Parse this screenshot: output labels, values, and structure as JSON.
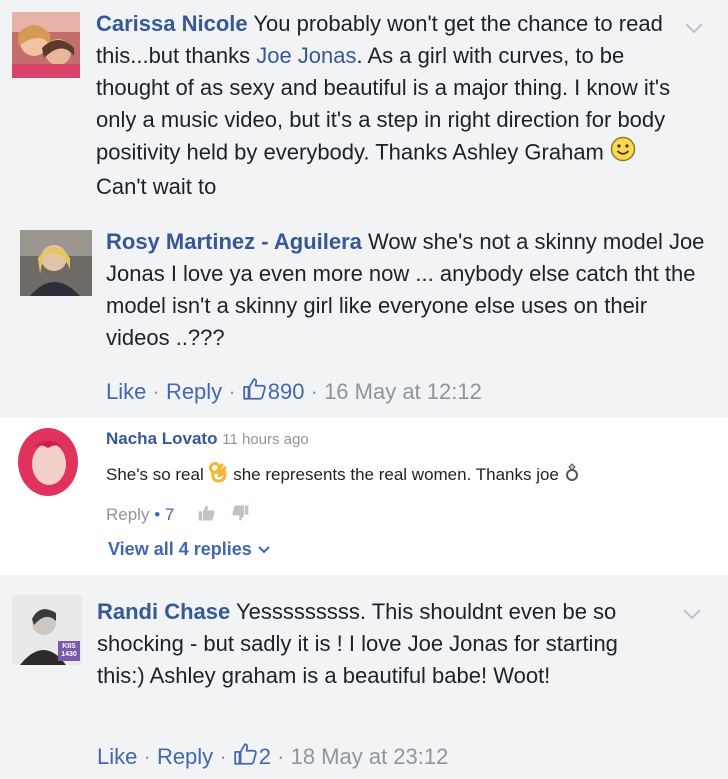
{
  "comments": [
    {
      "author": "Carissa Nicole",
      "text_1": " You probably won't get the chance to read this...but thanks ",
      "mention": "Joe Jonas",
      "text_2": ". As a girl with curves, to be thought of as sexy and beautiful is a major thing. I know it's only a music video, but it's a step in right direction for body positivity held by everybody. Thanks Ashley Graham ",
      "text_3": " Can't wait to",
      "emoji": "smiley-icon"
    },
    {
      "author": "Rosy Martinez - Aguilera",
      "text": " Wow she's not a skinny model Joe Jonas I love ya even more now ... anybody else catch tht the model isn't a skinny girl like everyone else uses on their videos ..???",
      "like_label": "Like",
      "reply_label": "Reply",
      "likes": "890",
      "timestamp": "16 May at 12:12"
    },
    {
      "author": "Nacha Lovato",
      "time_ago": "11 hours ago",
      "text_1": "She's so real ",
      "text_2": " she represents the real women. Thanks joe ",
      "reply_label": "Reply",
      "reply_count": "7",
      "view_replies": "View all 4 replies",
      "emoji_1": "ok-hand-icon",
      "emoji_2": "ring-icon"
    },
    {
      "author": "Randi Chase",
      "text": " Yesssssssss. This shouldnt even be so shocking - but sadly it is ! I love Joe Jonas for starting this:) Ashley graham is a beautiful babe! Woot!",
      "like_label": "Like",
      "reply_label": "Reply",
      "likes": "2",
      "timestamp": "18 May at 23:12",
      "avatar_badge": "KIIS 1430"
    }
  ],
  "separator": "·",
  "colors": {
    "link": "#365899",
    "action": "#4267b2",
    "meta": "#90949c",
    "panel": "#f2f3f5"
  }
}
